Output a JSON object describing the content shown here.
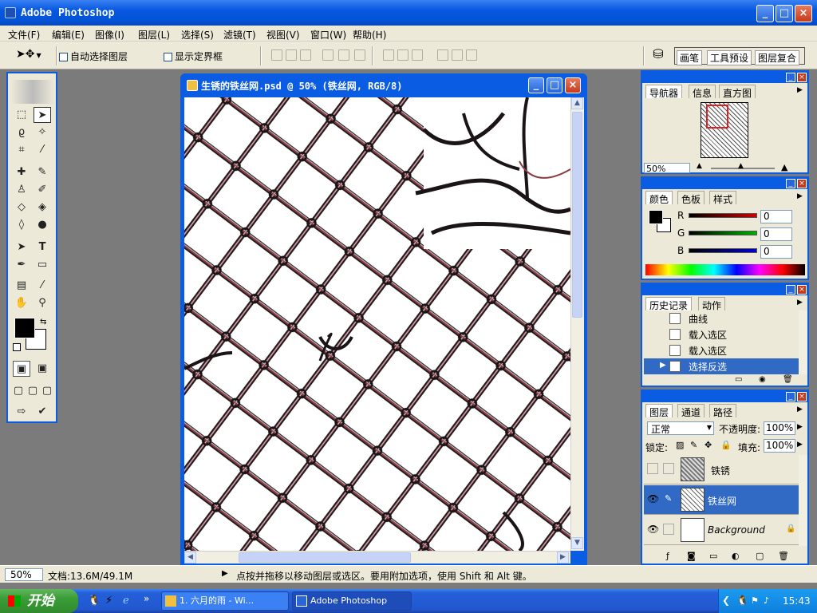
{
  "app": {
    "title": "Adobe Photoshop",
    "controls": [
      "_",
      "□",
      "×"
    ]
  },
  "menu": [
    "文件(F)",
    "编辑(E)",
    "图像(I)",
    "图层(L)",
    "选择(S)",
    "滤镜(T)",
    "视图(V)",
    "窗口(W)",
    "帮助(H)"
  ],
  "options": {
    "auto_select_label": "自动选择图层",
    "show_bounds_label": "显示定界框",
    "palette_tabs": [
      "画笔",
      "工具预设",
      "图层复合"
    ]
  },
  "document": {
    "title": "生锈的铁丝网.psd @ 50% (铁丝网, RGB/8)"
  },
  "status": {
    "zoom": "50%",
    "doc_size": "文档:13.6M/49.1M",
    "hint": "点按并拖移以移动图层或选区。要用附加选项，使用 Shift 和 Alt 键。"
  },
  "navigator": {
    "tabs": [
      "导航器",
      "信息",
      "直方图"
    ],
    "zoom": "50%"
  },
  "color": {
    "tabs": [
      "颜色",
      "色板",
      "样式"
    ],
    "channels": [
      {
        "label": "R",
        "value": "0",
        "color": "#d00000"
      },
      {
        "label": "G",
        "value": "0",
        "color": "#00b000"
      },
      {
        "label": "B",
        "value": "0",
        "color": "#0000d0"
      }
    ]
  },
  "history": {
    "tabs": [
      "历史记录",
      "动作"
    ],
    "items": [
      "曲线",
      "载入选区",
      "载入选区",
      "选择反选"
    ],
    "selected_index": 3
  },
  "layers": {
    "tabs": [
      "图层",
      "通道",
      "路径"
    ],
    "blend_mode": "正常",
    "opacity_label": "不透明度:",
    "opacity": "100%",
    "lock_label": "锁定:",
    "fill_label": "填充:",
    "fill": "100%",
    "items": [
      {
        "name": "铁锈",
        "visible": false,
        "selected": false
      },
      {
        "name": "铁丝网",
        "visible": true,
        "selected": true
      },
      {
        "name": "Background",
        "visible": true,
        "selected": false,
        "locked": true
      }
    ]
  },
  "taskbar": {
    "start": "开始",
    "tasks": [
      "1. 六月的雨 - Wi...",
      "Adobe Photoshop"
    ],
    "clock": "15:43"
  }
}
